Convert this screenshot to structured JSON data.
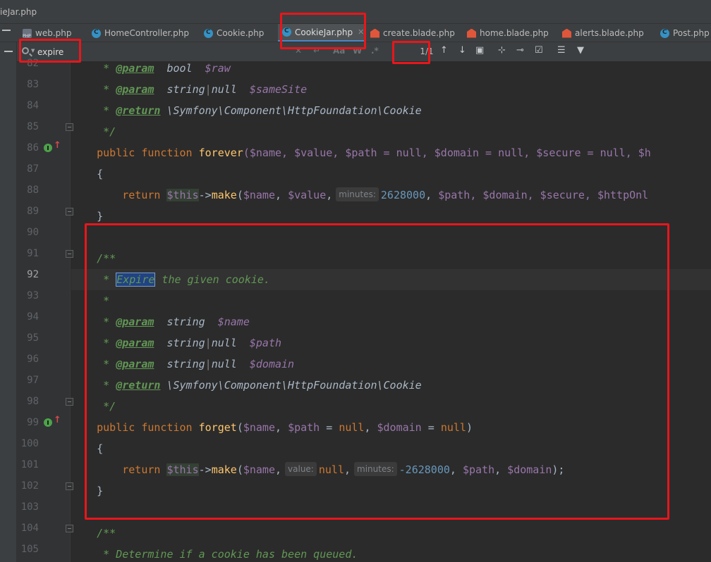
{
  "window": {
    "title": "ieJar.php"
  },
  "tabs": [
    {
      "label": "web.php",
      "icon": "php-file-icon",
      "active": false
    },
    {
      "label": "HomeController.php",
      "icon": "php-class-icon",
      "active": false
    },
    {
      "label": "Cookie.php",
      "icon": "php-class-icon",
      "active": false
    },
    {
      "label": "CookieJar.php",
      "icon": "php-class-icon",
      "active": true,
      "close": "✕"
    },
    {
      "label": "create.blade.php",
      "icon": "blade-file-icon",
      "active": false
    },
    {
      "label": "home.blade.php",
      "icon": "blade-file-icon",
      "active": false
    },
    {
      "label": "alerts.blade.php",
      "icon": "blade-file-icon",
      "active": false
    },
    {
      "label": "Post.php",
      "icon": "php-class-icon",
      "active": false
    }
  ],
  "search": {
    "query": "expire",
    "match_count": "1/1",
    "options": {
      "case": "Aa",
      "words": "W",
      "regex": ".*"
    }
  },
  "editor": {
    "current_line": 92,
    "line_numbers": [
      "82",
      "83",
      "84",
      "85",
      "86",
      "87",
      "88",
      "89",
      "90",
      "91",
      "92",
      "93",
      "94",
      "95",
      "96",
      "97",
      "98",
      "99",
      "100",
      "101",
      "102",
      "103",
      "104",
      "105"
    ],
    "doc": {
      "param": "@param",
      "return": "@return",
      "type_bool": "bool",
      "type_string": "string",
      "type_null": "null",
      "var_raw": "$raw",
      "var_samesite": "$sameSite",
      "var_name": "$name",
      "var_path": "$path",
      "var_domain": "$domain",
      "return_type": "\\Symfony\\Component\\HttpFoundation\\Cookie",
      "close": "*/",
      "open": "/**",
      "star": "*",
      "expire_match": "Expire",
      "expire_rest": " the given cookie.",
      "queued_desc": "Determine if a cookie has been queued."
    },
    "code": {
      "kw_public": "public",
      "kw_function": "function",
      "kw_return": "return",
      "fn_forever": "forever",
      "fn_forget": "forget",
      "fn_make": "make",
      "this": "$this",
      "arrow": "->",
      "forever_sig": "($name, $value, $path = null, $domain = null, $secure = null, $h",
      "forget_sig_open": "(",
      "forget_sig_name": "$name",
      "forget_sig_path": "$path",
      "forget_sig_domain": "$domain",
      "null": "null",
      "hint_minutes": "minutes:",
      "hint_value": "value:",
      "forever_minutes": "2628000",
      "forever_rest": "$path, $domain, $secure, $httpOnl",
      "forget_minutes": "-2628000",
      "brace_open": "{",
      "brace_close": "}"
    }
  },
  "colors": {
    "annotation_red": "#e8161b",
    "keyword": "#cc7832",
    "function": "#ffc66d",
    "variable": "#9876aa",
    "doc_comment": "#629755",
    "number": "#6897bb"
  }
}
